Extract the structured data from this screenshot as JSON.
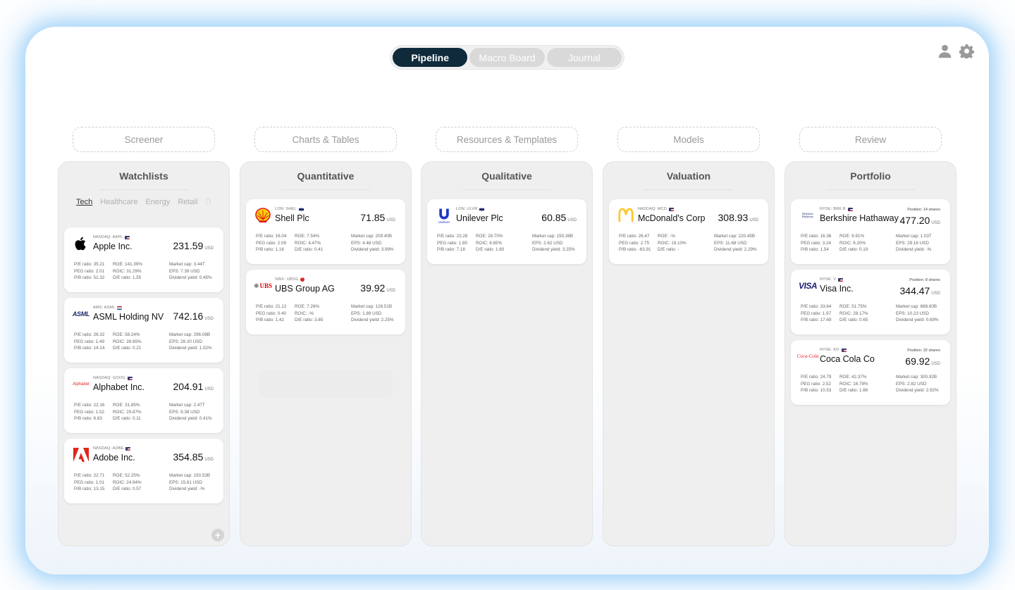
{
  "nav": {
    "tabs": [
      {
        "label": "Pipeline",
        "active": true
      },
      {
        "label": "Macro Board",
        "active": false
      },
      {
        "label": "Journal",
        "active": false
      }
    ],
    "icons": [
      "user-icon",
      "gear-icon"
    ]
  },
  "stages": [
    "Screener",
    "Charts & Tables",
    "Resources & Templates",
    "Models",
    "Review"
  ],
  "columns": {
    "watchlists": {
      "title": "Watchlists",
      "tabs": [
        "Tech",
        "Healthcare",
        "Energy",
        "Retail",
        "De"
      ],
      "active_tab": "Tech",
      "cards": [
        {
          "logo": "apple-logo-icon",
          "flag": "us",
          "exchange": "NASDAQ: AAPL",
          "name": "Apple Inc.",
          "price": "231.59",
          "currency": "USD",
          "pe": "P/E ratio: 35.21",
          "peg": "PEG ratio: 2.01",
          "pb": "P/B ratio: 51.32",
          "roe": "ROE: 141.39%",
          "roic": "ROIC: 31.29%",
          "de": "D/E ratio: 1.55",
          "mcap": "Market cap: 3.44T",
          "eps": "EPS: 7.39 USD",
          "div": "Dividend yield: 0.45%"
        },
        {
          "logo": "asml-logo-icon",
          "flag": "nl",
          "exchange": "AMS: ASML",
          "name": "ASML Holding NV",
          "price": "742.16",
          "currency": "USD",
          "pe": "P/E ratio: 26.32",
          "peg": "PEG ratio: 1.49",
          "pb": "P/B ratio: 14.14",
          "roe": "ROE: 58.24%",
          "roic": "ROIC: 28.65%",
          "de": "D/E ratio: 0.21",
          "mcap": "Market cap: 296.08B",
          "eps": "EPS: 28.20 USD",
          "div": "Dividend yield: 1.02%"
        },
        {
          "logo": "alphabet-logo-icon",
          "flag": "us",
          "exchange": "NASDAQ: GOOG",
          "name": "Alphabet Inc.",
          "price": "204.91",
          "currency": "USD",
          "pe": "P/E ratio: 22.16",
          "peg": "PEG ratio: 1.52",
          "pb": "P/B ratio: 6.83",
          "roe": "ROE: 31.85%",
          "roic": "ROIC: 29.87%",
          "de": "D/E ratio: 0.11",
          "mcap": "Market cap: 2.47T",
          "eps": "EPS: 9.38 USD",
          "div": "Dividend yield: 0.41%"
        },
        {
          "logo": "adobe-logo-icon",
          "flag": "us",
          "exchange": "NASDAQ: ADBE",
          "name": "Adobe Inc.",
          "price": "354.85",
          "currency": "USD",
          "pe": "P/E ratio: 22.71",
          "peg": "PEG ratio: 1.01",
          "pb": "P/B ratio: 13.15",
          "roe": "ROE: 52.25%",
          "roic": "ROIC: 24.94%",
          "de": "D/E ratio: 0.57",
          "mcap": "Market cap: 150.53B",
          "eps": "EPS: 15.61 USD",
          "div": "Dividend yield: -%"
        }
      ],
      "add_label": "+"
    },
    "quantitative": {
      "title": "Quantitative",
      "cards": [
        {
          "logo": "shell-logo-icon",
          "flag": "gb",
          "exchange": "LON: SHEL",
          "name": "Shell Plc",
          "price": "71.85",
          "currency": "USD",
          "pe": "P/E ratio: 16.04",
          "peg": "PEG ratio: 2.09",
          "pb": "P/B ratio: 1.16",
          "roe": "ROE: 7.54%",
          "roic": "ROIC: 4.47%",
          "de": "D/E ratio: 0.41",
          "mcap": "Market cap: 209.40B",
          "eps": "EPS: 4.48 USD",
          "div": "Dividend yield: 3.99%"
        },
        {
          "logo": "ubs-logo-icon",
          "flag": "ch",
          "exchange": "SWX: UBSG",
          "name": "UBS Group AG",
          "price": "39.92",
          "currency": "USD",
          "pe": "P/E ratio: 21.12",
          "peg": "PEG ratio: 0.40",
          "pb": "P/B ratio: 1.42",
          "roe": "ROE: 7.26%",
          "roic": "ROIC: -%",
          "de": "D/E ratio: 3.85",
          "mcap": "Market cap: 126.51B",
          "eps": "EPS: 1.89 USD",
          "div": "Dividend yield: 2.25%"
        }
      ]
    },
    "qualitative": {
      "title": "Qualitative",
      "cards": [
        {
          "logo": "unilever-logo-icon",
          "flag": "gb",
          "exchange": "LON: ULVR",
          "name": "Unilever Plc",
          "price": "60.85",
          "currency": "USD",
          "pe": "P/E ratio: 23.28",
          "peg": "PEG ratio: 1.80",
          "pb": "P/B ratio: 7.18",
          "roe": "ROE: 28.70%",
          "roic": "ROIC: 6.65%",
          "de": "D/E ratio: 1.60",
          "mcap": "Market cap: 150.38B",
          "eps": "EPS: 2.62 USD",
          "div": "Dividend yield: 3.25%"
        }
      ]
    },
    "valuation": {
      "title": "Valuation",
      "cards": [
        {
          "logo": "mcdonalds-logo-icon",
          "flag": "us",
          "exchange": "NASDAQ: MCD",
          "name": "McDonald's Corp",
          "price": "308.93",
          "currency": "USD",
          "pe": "P/E ratio: 26.47",
          "peg": "PEG ratio: 2.75",
          "pb": "P/B ratio: -63.91",
          "roe": "ROE: -%",
          "roic": "ROIC: 19.10%",
          "de": "D/E ratio: -",
          "mcap": "Market cap: 220.45B",
          "eps": "EPS: 11.68 USD",
          "div": "Dividend yield: 2.29%"
        }
      ]
    },
    "portfolio": {
      "title": "Portfolio",
      "cards": [
        {
          "logo": "berkshire-logo-icon",
          "flag": "us",
          "exchange": "NYSE: BRK.B",
          "name": "Berkshire Hathaway",
          "position": "Position: 14 shares",
          "price": "477.20",
          "currency": "USD",
          "pe": "P/E ratio: 16.36",
          "peg": "PEG ratio: 3.24",
          "pb": "P/B ratio: 1.54",
          "roe": "ROE: 9.91%",
          "roic": "ROIC: 6.20%",
          "de": "D/E ratio: 0.19",
          "mcap": "Market cap: 1.03T",
          "eps": "EPS: 29.16 USD",
          "div": "Dividend yield: -%"
        },
        {
          "logo": "visa-logo-icon",
          "flag": "us",
          "exchange": "NYSE: V",
          "name": "Visa Inc.",
          "position": "Position: 8 shares",
          "price": "344.47",
          "currency": "USD",
          "pe": "P/E ratio: 33.64",
          "peg": "PEG ratio: 1.97",
          "pb": "P/B ratio: 17.69",
          "roe": "ROE: 51.75%",
          "roic": "ROIC: 28.17%",
          "de": "D/E ratio: 0.65",
          "mcap": "Market cap: 668.60B",
          "eps": "EPS: 10.23 USD",
          "div": "Dividend yield: 0.69%"
        },
        {
          "logo": "cocacola-logo-icon",
          "flag": "us",
          "exchange": "NYSE: KO",
          "name": "Coca Cola Co",
          "position": "Position: 32 shares",
          "price": "69.92",
          "currency": "USD",
          "pe": "P/E ratio: 24.79",
          "peg": "PEG ratio: 2.52",
          "pb": "P/B ratio: 10.53",
          "roe": "ROE: 42.37%",
          "roic": "ROIC: 16.78%",
          "de": "D/E ratio: 1.66",
          "mcap": "Market cap: 300.92B",
          "eps": "EPS: 2.82 USD",
          "div": "Dividend yield: 2.92%"
        }
      ]
    }
  },
  "logo_text": {
    "asml": "ASML",
    "alphabet": "Alphabet",
    "ubs": "UBS",
    "unilever": "Unilever",
    "berkshire": "Berkshire Hathaway",
    "visa": "VISA",
    "cocacola": "Coca-Cola"
  }
}
